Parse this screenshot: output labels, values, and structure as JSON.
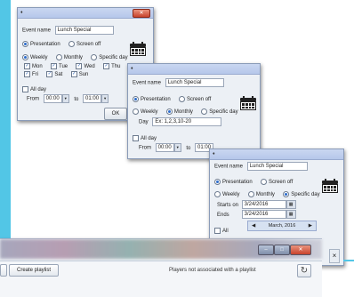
{
  "colors": {
    "accent": "#52c6e6",
    "title_bar": "#b5c7ea",
    "close": "#c8432c",
    "radio_on": "#2a6bcc"
  },
  "dialog1": {
    "event_name_label": "Event name",
    "event_name_value": "Lunch Special",
    "presentation_label": "Presentation",
    "screen_off_label": "Screen off",
    "weekly_label": "Weekly",
    "monthly_label": "Monthly",
    "specific_day_label": "Specific day",
    "days": [
      "Mon",
      "Tue",
      "Wed",
      "Thu",
      "Fri",
      "Sat",
      "Sun"
    ],
    "all_day_label": "All day",
    "from_label": "From",
    "from_value": "00:00",
    "to_label": "to",
    "to_value": "01:00",
    "ok_label": "OK",
    "calendar_icon": "calendar-icon"
  },
  "dialog2": {
    "event_name_label": "Event name",
    "event_name_value": "Lunch Special",
    "presentation_label": "Presentation",
    "screen_off_label": "Screen off",
    "weekly_label": "Weekly",
    "monthly_label": "Monthly",
    "specific_day_label": "Specific day",
    "day_label": "Day",
    "day_value": "Ex: 1,2,3,10-20",
    "all_day_label": "All day",
    "from_label": "From",
    "from_value": "00:00",
    "to_label": "to",
    "to_value": "01:00"
  },
  "dialog3": {
    "event_name_label": "Event name",
    "event_name_value": "Lunch Special",
    "presentation_label": "Presentation",
    "screen_off_label": "Screen off",
    "weekly_label": "Weekly",
    "monthly_label": "Monthly",
    "specific_day_label": "Specific day",
    "starts_on_label": "Starts on",
    "starts_on_value": "3/24/2016",
    "ends_label": "Ends",
    "ends_value": "3/24/2016",
    "calendar_month": "March, 2016",
    "all_day_label": "All"
  },
  "main_window": {
    "create_playlist_label": "Create playlist",
    "players_text": "Players not associated with a playlist"
  }
}
